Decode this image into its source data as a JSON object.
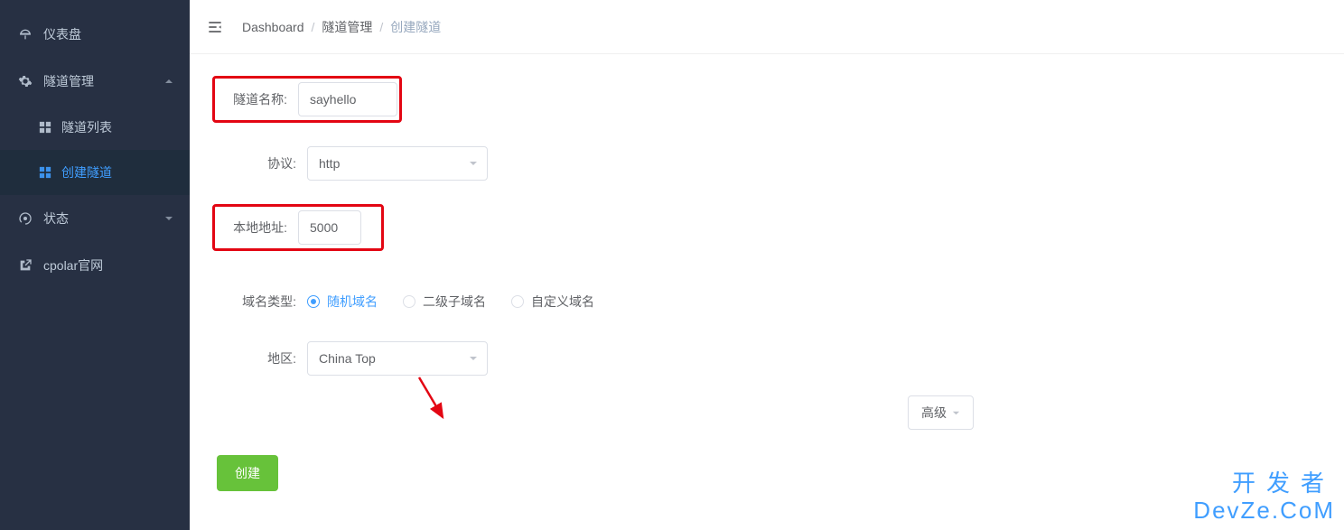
{
  "sidebar": {
    "items": [
      {
        "label": "仪表盘"
      },
      {
        "label": "隧道管理"
      },
      {
        "label": "隧道列表"
      },
      {
        "label": "创建隧道"
      },
      {
        "label": "状态"
      },
      {
        "label": "cpolar官网"
      }
    ]
  },
  "breadcrumb": {
    "dashboard": "Dashboard",
    "tunnel_mgmt": "隧道管理",
    "create_tunnel": "创建隧道"
  },
  "form": {
    "tunnel_name_label": "隧道名称:",
    "tunnel_name_value": "sayhello",
    "protocol_label": "协议:",
    "protocol_value": "http",
    "local_addr_label": "本地地址:",
    "local_addr_value": "5000",
    "domain_type_label": "域名类型:",
    "domain_options": {
      "random": "随机域名",
      "subdomain": "二级子域名",
      "custom": "自定义域名"
    },
    "region_label": "地区:",
    "region_value": "China Top",
    "advanced_label": "高级",
    "create_btn": "创建"
  },
  "watermark": {
    "line1": "开发者",
    "line2": "DevZe.CoM"
  }
}
